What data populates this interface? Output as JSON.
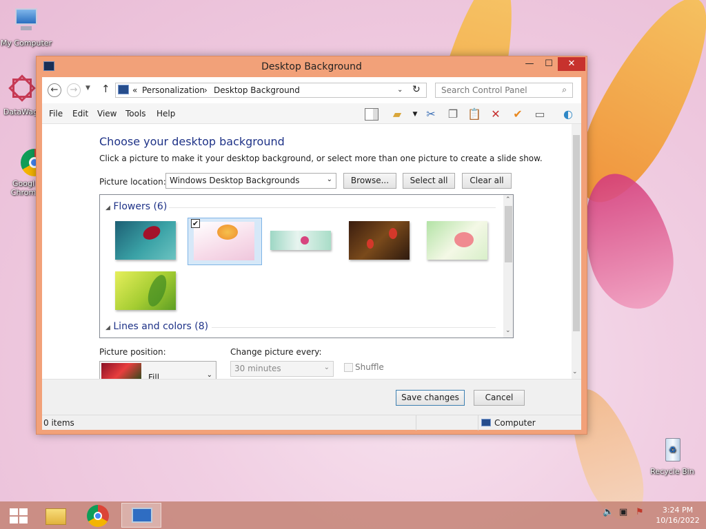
{
  "desktop": {
    "icons": [
      {
        "label": "My Computer"
      },
      {
        "label": "DataWag"
      },
      {
        "label": "Googl Chrom"
      },
      {
        "label": "Recycle Bin"
      }
    ]
  },
  "window": {
    "title": "Desktop Background",
    "address": {
      "prefix": "«",
      "crumb1": "Personalization",
      "sep": "›",
      "crumb2": "Desktop Background"
    },
    "search": {
      "placeholder": "Search Control Panel"
    },
    "menu": [
      "File",
      "Edit",
      "View",
      "Tools",
      "Help"
    ],
    "heading": "Choose your desktop background",
    "description": "Click a picture to make it your desktop background, or select more than one picture to create a slide show.",
    "picture_location": {
      "label": "Picture location:",
      "value": "Windows Desktop Backgrounds"
    },
    "buttons": {
      "browse": "Browse...",
      "select_all": "Select all",
      "clear_all": "Clear all",
      "save": "Save changes",
      "cancel": "Cancel"
    },
    "groups": [
      {
        "label": "Flowers (6)",
        "expanded": true,
        "selected_index": 1
      },
      {
        "label": "Lines and colors (8)",
        "expanded": true
      }
    ],
    "picture_position": {
      "label": "Picture position:",
      "value": "Fill"
    },
    "change_every": {
      "label": "Change picture every:",
      "value": "30 minutes",
      "enabled": false
    },
    "shuffle": {
      "label": "Shuffle",
      "checked": false,
      "enabled": false
    },
    "status": {
      "items": "0 items",
      "location": "Computer"
    }
  },
  "taskbar": {
    "clock": {
      "time": "3:24 PM",
      "date": "10/16/2022"
    }
  },
  "colors": {
    "accent_heading": "#1e3287",
    "window_frame": "#f2a179",
    "close_button": "#c7322d"
  }
}
